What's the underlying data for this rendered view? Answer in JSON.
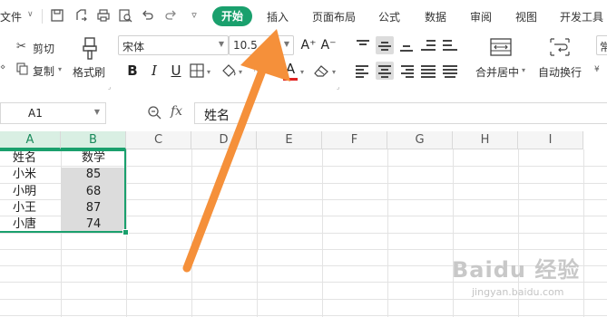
{
  "menu": {
    "file_label": "文件",
    "tabs": [
      "开始",
      "插入",
      "页面布局",
      "公式",
      "数据",
      "审阅",
      "视图",
      "开发工具"
    ],
    "active_tab": "开始"
  },
  "ribbon": {
    "cut_label": "剪切",
    "copy_label": "复制",
    "format_painter_label": "格式刷",
    "font_name": "宋体",
    "font_size": "10.5",
    "bold": "B",
    "italic": "I",
    "underline": "U",
    "font_color_letter": "A",
    "grow_font": "A⁺",
    "shrink_font": "A⁻",
    "merge_center_label": "合并居中",
    "wrap_text_label": "自动换行",
    "cut_off_label": "常",
    "colors": {
      "font_color_bar": "#e02020",
      "accent": "#1aa06d"
    }
  },
  "formula_bar": {
    "name_box": "A1",
    "fx_label": "fx",
    "content": "姓名"
  },
  "sheet": {
    "columns": [
      "A",
      "B",
      "C",
      "D",
      "E",
      "F",
      "G",
      "H",
      "I"
    ],
    "selected_columns": [
      "A",
      "B"
    ],
    "rows": [
      [
        "姓名",
        "数学"
      ],
      [
        "小米",
        "85"
      ],
      [
        "小明",
        "68"
      ],
      [
        "小王",
        "87"
      ],
      [
        "小唐",
        "74"
      ]
    ]
  },
  "watermark": {
    "brand": "Baidu 经验",
    "url": "jingyan.baidu.com"
  }
}
